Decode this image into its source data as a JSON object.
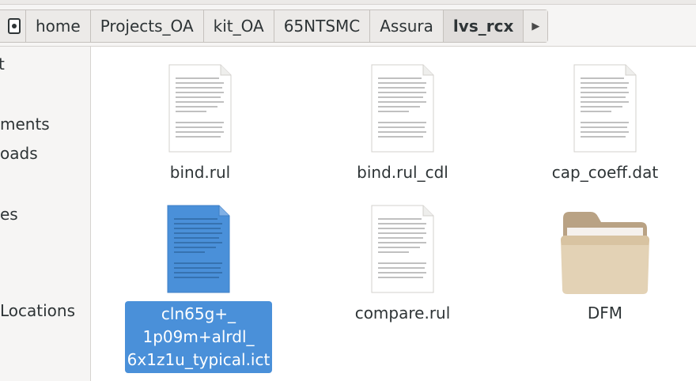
{
  "pathbar": {
    "root_icon": "drive-icon",
    "crumbs": [
      "home",
      "Projects_OA",
      "kit_OA",
      "65NTSMC",
      "Assura",
      "lvs_rcx"
    ],
    "next_icon": "chevron-right-icon"
  },
  "sidebar": {
    "items": [
      {
        "label": "t"
      },
      {
        "label": "ments"
      },
      {
        "label": "oads"
      },
      {
        "label": "es"
      },
      {
        "label": "Locations"
      }
    ]
  },
  "files": [
    {
      "name": "bind.rul",
      "kind": "text-document",
      "icon": "text-file-icon"
    },
    {
      "name": "bind.rul_cdl",
      "kind": "text-document",
      "icon": "text-file-icon"
    },
    {
      "name": "cap_coeff.dat",
      "kind": "text-document",
      "icon": "text-file-icon"
    },
    {
      "name_lines": [
        "cln65g+_",
        "1p09m+alrdl_",
        "6x1z1u_typical.ict"
      ],
      "kind": "text-document",
      "icon": "text-file-icon",
      "selected": true
    },
    {
      "name": "compare.rul",
      "kind": "text-document",
      "icon": "text-file-icon"
    },
    {
      "name": "DFM",
      "kind": "folder",
      "icon": "folder-icon"
    }
  ],
  "colors": {
    "selection": "#4a90d9",
    "folder": "#d9c6a5",
    "background": "#ffffff",
    "sidebar": "#f6f5f4"
  }
}
